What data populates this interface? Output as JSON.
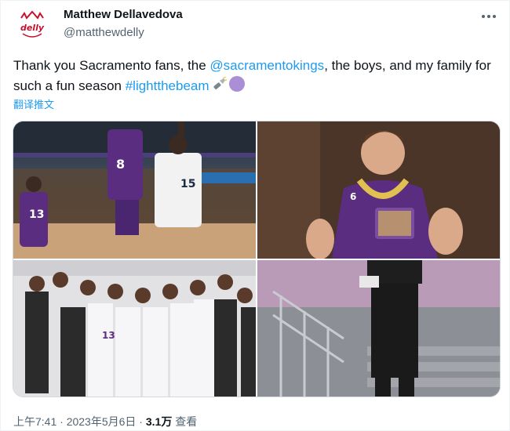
{
  "author": {
    "display_name": "Matthew Dellavedova",
    "handle": "@matthewdelly",
    "avatar_text": "delly"
  },
  "tweet": {
    "text_part1": "Thank you Sacramento fans, the ",
    "mention": "@sacramentokings",
    "text_part2": ", the boys, and my family for such a fun season ",
    "hashtag": "#lightthebeam",
    "emojis": [
      "flashlight-icon",
      "purple-circle-icon"
    ],
    "translate_label": "翻译推文"
  },
  "media": {
    "tiles": [
      {
        "name": "game-action-photo",
        "jersey_numbers": [
          "8",
          "15",
          "13"
        ]
      },
      {
        "name": "chain-portrait-photo",
        "jersey_number": "6"
      },
      {
        "name": "team-group-photo",
        "jersey_number": "13"
      },
      {
        "name": "walking-hallway-photo"
      }
    ]
  },
  "meta": {
    "time": "上午7:41",
    "separator": " · ",
    "date": "2023年5月6日",
    "views_count": "3.1万",
    "views_label": " 查看"
  },
  "colors": {
    "accent": "#1d9bf0",
    "kings_purple": "#5a2d81",
    "text_primary": "#0f1419",
    "text_secondary": "#536471"
  }
}
